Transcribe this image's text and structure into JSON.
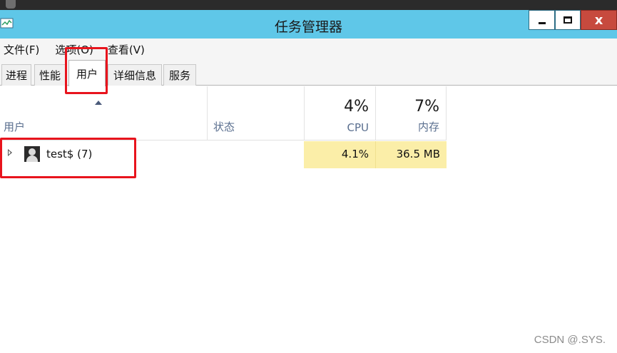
{
  "window": {
    "title": "任务管理器",
    "min_label": "",
    "close_label": "x"
  },
  "menu": [
    "文件(F)",
    "选项(O)",
    "查看(V)"
  ],
  "tabs": [
    {
      "label": "进程",
      "active": false
    },
    {
      "label": "性能",
      "active": false
    },
    {
      "label": "用户",
      "active": true
    },
    {
      "label": "详细信息",
      "active": false
    },
    {
      "label": "服务",
      "active": false
    }
  ],
  "columns": {
    "user": {
      "label": "用户"
    },
    "status": {
      "label": "状态"
    },
    "cpu": {
      "label": "CPU",
      "percent": "4%"
    },
    "memory": {
      "label": "内存",
      "percent": "7%"
    }
  },
  "rows": [
    {
      "name": "test$ (7)",
      "status": "",
      "cpu": "4.1%",
      "memory": "36.5 MB"
    }
  ],
  "watermark": "CSDN @.SYS.",
  "colors": {
    "titlebar": "#5fc7e8",
    "close_button": "#c74a3e",
    "highlight_cell": "#fbeea8",
    "annotation": "#e8141d"
  }
}
